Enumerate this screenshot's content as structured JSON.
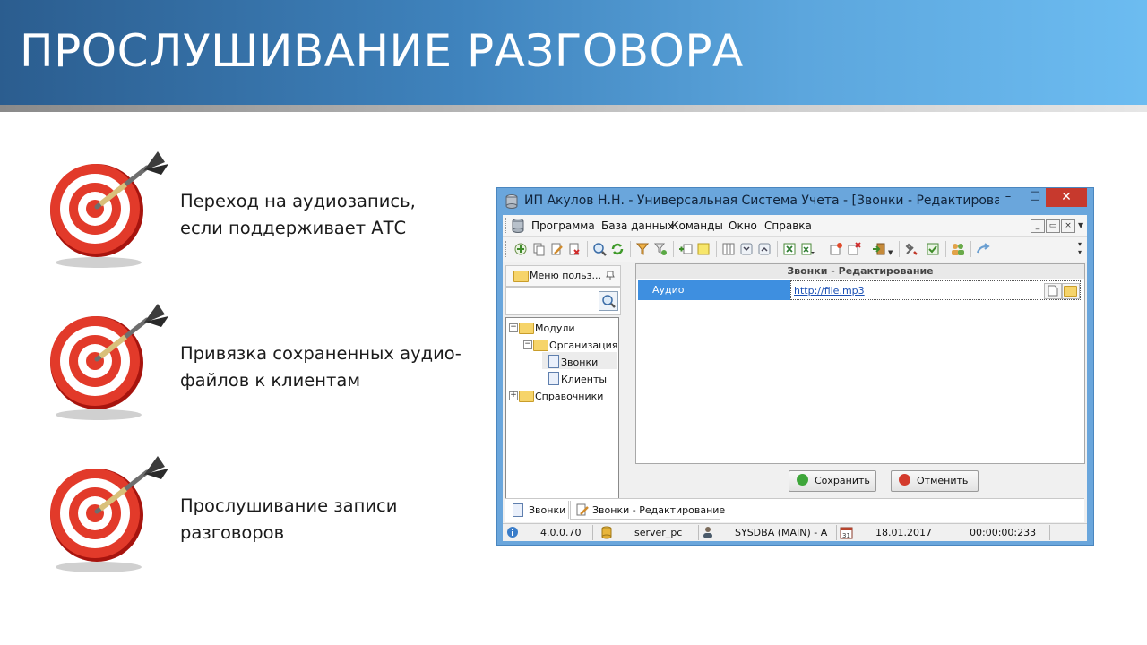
{
  "slide": {
    "title": "ПРОСЛУШИВАНИЕ РАЗГОВОРА",
    "bullets": [
      {
        "line1": "Переход на аудиозапись,",
        "line2": "если поддерживает АТС",
        "icon": "target-icon"
      },
      {
        "line1": "Привязка сохраненных аудио-",
        "line2": "файлов к клиентам",
        "icon": "target-icon"
      },
      {
        "line1": "Прослушивание записи",
        "line2": "разговоров",
        "icon": "target-icon"
      }
    ]
  },
  "window": {
    "title": "ИП Акулов Н.Н. - Универсальная Система Учета - [Звонки - Редактирован...",
    "minimize": "–",
    "maximize": "□",
    "close": "✕",
    "menu": [
      "Программа",
      "База данных",
      "Команды",
      "Окно",
      "Справка"
    ],
    "mdi_buttons": [
      "_",
      "▭",
      "×"
    ],
    "left_panel": {
      "header": "Меню польз...",
      "tree": {
        "root": "Модули",
        "child": "Организация",
        "leaf1": "Звонки",
        "leaf2": "Клиенты",
        "root2": "Справочники"
      }
    },
    "form": {
      "header": "Звонки - Редактирование",
      "field_label": "Аудио",
      "field_value": "http://file.mp3"
    },
    "buttons": {
      "save": "Сохранить",
      "cancel": "Отменить"
    },
    "tabs": [
      "Звонки",
      "Звонки - Редактирование"
    ],
    "status": {
      "version": "4.0.0.70",
      "server": "server_pc",
      "user": "SYSDBA (MAIN) - A",
      "date": "18.01.2017",
      "timer": "00:00:00:233"
    }
  },
  "colors": {
    "banner_start": "#2b5d8f",
    "banner_end": "#6cbcf1",
    "window_frame": "#6aa6dc",
    "selection": "#3e8fe0",
    "close_button": "#c7392d"
  }
}
